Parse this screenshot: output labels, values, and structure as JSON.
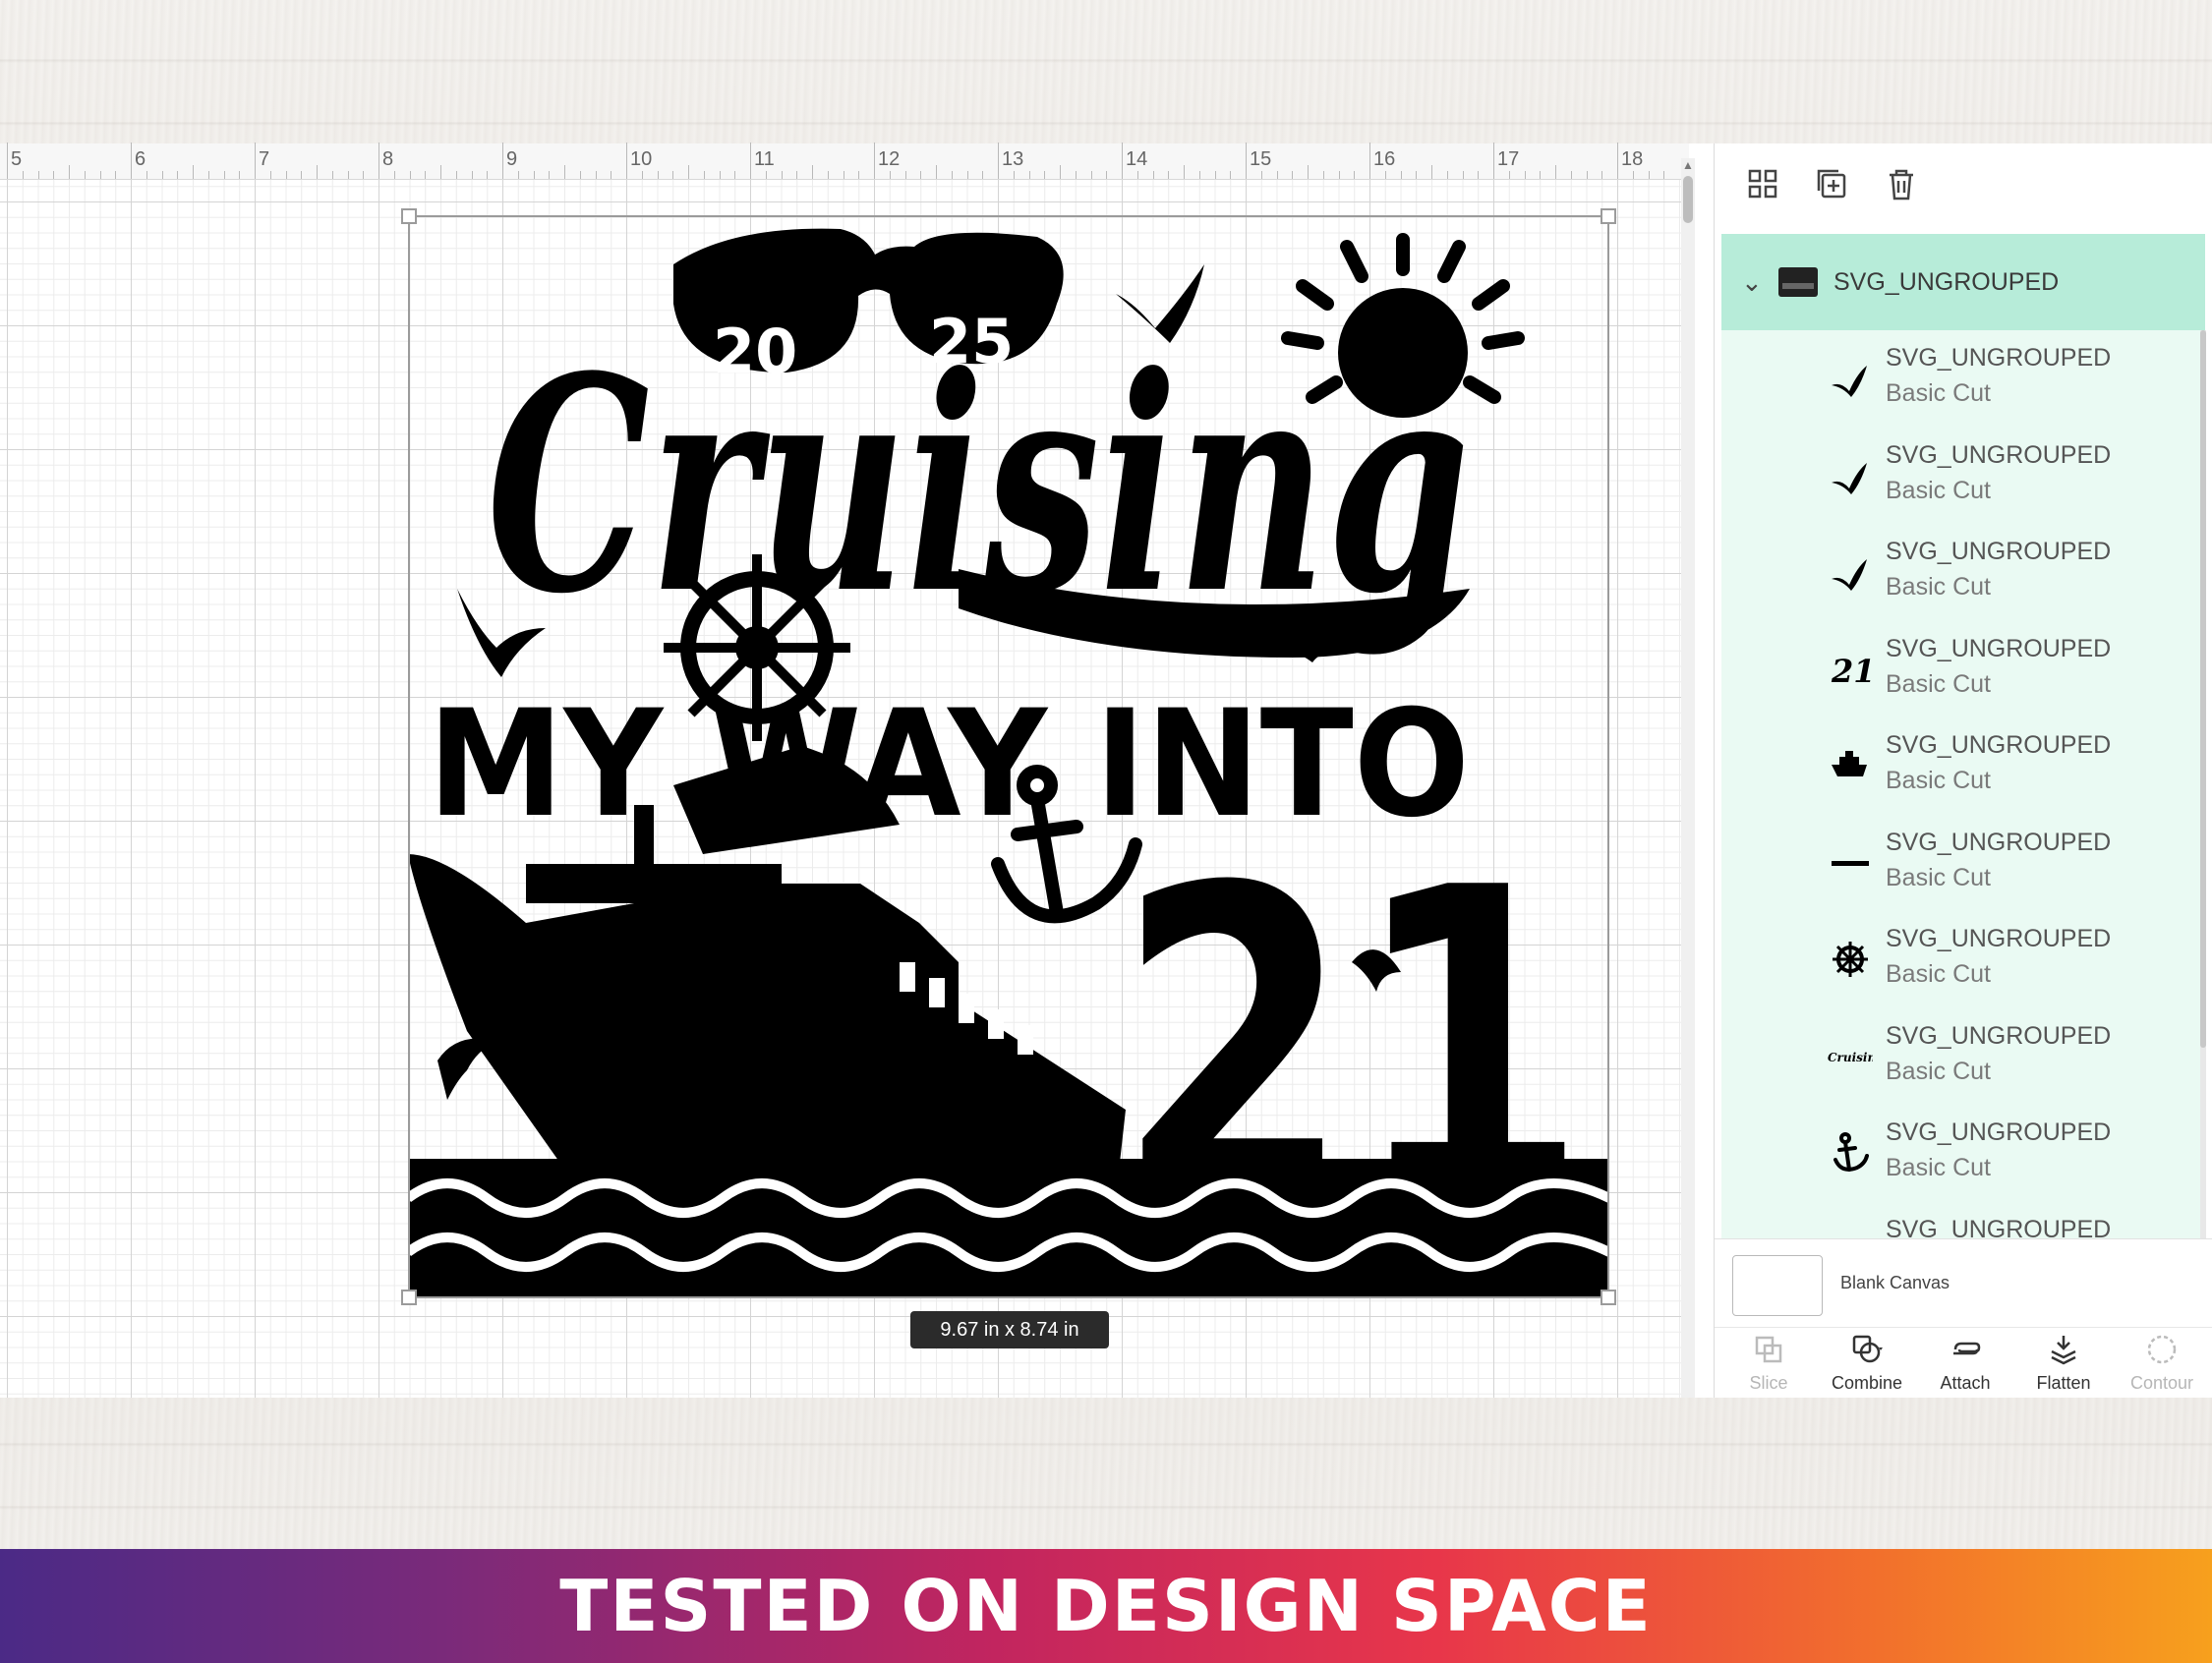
{
  "ruler": {
    "numbers": [
      "5",
      "6",
      "7",
      "8",
      "9",
      "10",
      "11",
      "12",
      "13",
      "14",
      "15",
      "16",
      "17",
      "18"
    ]
  },
  "design": {
    "year_left": "20",
    "year_right": "25",
    "title": "Cruising",
    "subtitle": "MY WAY INTO",
    "number": "21"
  },
  "selection": {
    "dimensions": "9.67  in x 8.74  in"
  },
  "panel": {
    "group": {
      "name": "SVG_UNGROUPED"
    },
    "layers": [
      {
        "name": "SVG_UNGROUPED",
        "type": "Basic Cut",
        "icon": "seagull-icon"
      },
      {
        "name": "SVG_UNGROUPED",
        "type": "Basic Cut",
        "icon": "seagull-icon"
      },
      {
        "name": "SVG_UNGROUPED",
        "type": "Basic Cut",
        "icon": "seagull-icon"
      },
      {
        "name": "SVG_UNGROUPED",
        "type": "Basic Cut",
        "icon": "number-21-icon",
        "icon_text": "21"
      },
      {
        "name": "SVG_UNGROUPED",
        "type": "Basic Cut",
        "icon": "ship-icon"
      },
      {
        "name": "SVG_UNGROUPED",
        "type": "Basic Cut",
        "icon": "text-strip-icon"
      },
      {
        "name": "SVG_UNGROUPED",
        "type": "Basic Cut",
        "icon": "ship-wheel-icon"
      },
      {
        "name": "SVG_UNGROUPED",
        "type": "Basic Cut",
        "icon": "cruising-script-icon",
        "icon_text": "Cruising"
      },
      {
        "name": "SVG_UNGROUPED",
        "type": "Basic Cut",
        "icon": "anchor-icon"
      },
      {
        "name": "SVG_UNGROUPED",
        "type": "",
        "icon": "partial-icon"
      }
    ],
    "blank_canvas": "Blank Canvas",
    "actions": [
      {
        "label": "Slice",
        "enabled": false
      },
      {
        "label": "Combine",
        "enabled": true
      },
      {
        "label": "Attach",
        "enabled": true
      },
      {
        "label": "Flatten",
        "enabled": true
      },
      {
        "label": "Contour",
        "enabled": false
      }
    ]
  },
  "banner": {
    "text": "TESTED ON DESIGN SPACE"
  },
  "colors": {
    "selected_layer_bg": "#b7ecd9",
    "layer_list_bg": "#eafaf3",
    "artwork": "#000000",
    "banner_gradient": [
      "#4b2a86",
      "#c2255f",
      "#e8364a",
      "#f7a01d"
    ]
  }
}
